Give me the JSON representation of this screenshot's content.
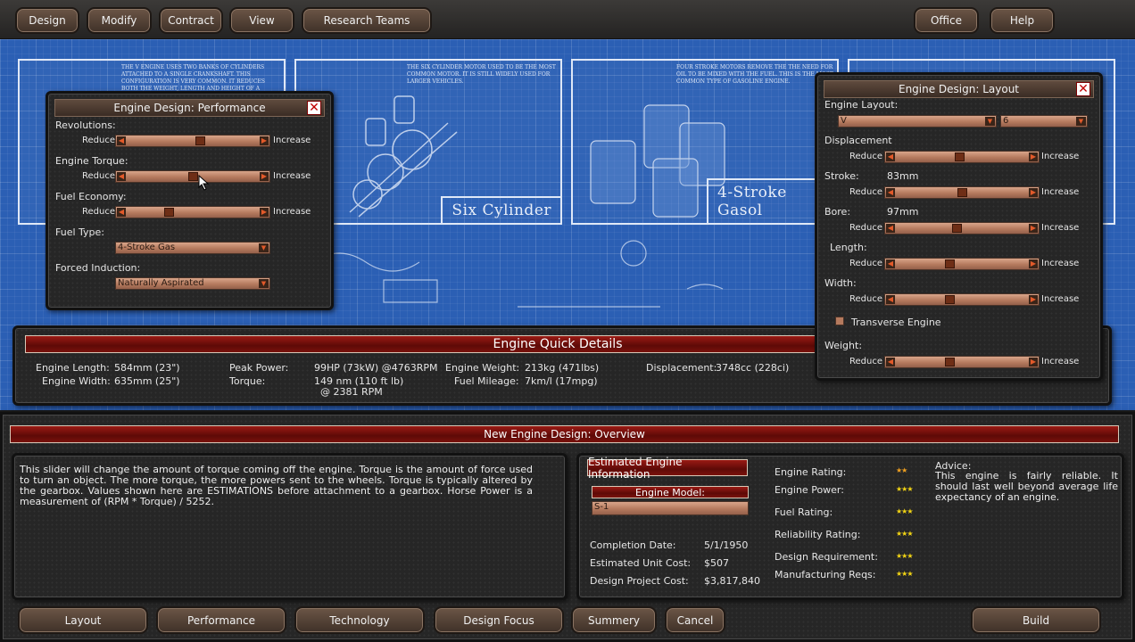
{
  "top_nav": {
    "design": "Design",
    "modify": "Modify",
    "contract": "Contract",
    "view": "View",
    "research_teams": "Research Teams",
    "office": "Office",
    "help": "Help"
  },
  "blueprint": {
    "cards": [
      {
        "caption": "",
        "blurb": "The V engine uses two banks of cylinders attached to a single crankshaft. This configuration is very common. It reduces both the weight, length and height of a straight engine."
      },
      {
        "caption": "Six Cylinder",
        "blurb": "The six cylinder motor used to be the most common motor. It is still widely used for larger vehicles."
      },
      {
        "caption": "4-Stroke Gasol",
        "blurb": "Four stroke motors remove the the need for oil to be mixed with the fuel. This is the most common type of gasoline engine."
      }
    ]
  },
  "performance_panel": {
    "title": "Engine Design: Performance",
    "reduce": "Reduce",
    "increase": "Increase",
    "revolutions_label": "Revolutions:",
    "revolutions_value": 0.56,
    "torque_label": "Engine Torque:",
    "torque_value": 0.5,
    "fuel_economy_label": "Fuel Economy:",
    "fuel_economy_value": 0.31,
    "fuel_type_label": "Fuel Type:",
    "fuel_type_value": "4-Stroke Gas",
    "forced_induction_label": "Forced Induction:",
    "forced_induction_value": "Naturally Aspirated"
  },
  "layout_panel": {
    "title": "Engine Design: Layout",
    "engine_layout_label": "Engine Layout:",
    "layout_value": "V",
    "cylinders_value": "6",
    "reduce": "Reduce",
    "increase": "Increase",
    "displacement_label": "Displacement",
    "displacement_slider": 0.48,
    "stroke_label": "Stroke:",
    "stroke_value": "83mm",
    "stroke_slider": 0.5,
    "bore_label": "Bore:",
    "bore_value": "97mm",
    "bore_slider": 0.46,
    "length_label": "Length:",
    "length_slider": 0.4,
    "width_label": "Width:",
    "width_slider": 0.4,
    "transverse_label": "Transverse Engine",
    "transverse_checked": false,
    "weight_label": "Weight:",
    "weight_slider": 0.4
  },
  "quick_details": {
    "title": "Engine Quick Details",
    "engine_length_label": "Engine Length:",
    "engine_length_value": "584mm (23\")",
    "engine_width_label": "Engine Width:",
    "engine_width_value": "635mm (25\")",
    "peak_power_label": "Peak Power:",
    "peak_power_value": "99HP (73kW) @4763RPM",
    "torque_label": "Torque:",
    "torque_value": "149 nm (110 ft lb)",
    "torque_rpm": "@ 2381 RPM",
    "engine_weight_label": "Engine Weight:",
    "engine_weight_value": "213kg (471lbs)",
    "fuel_mileage_label": "Fuel Mileage:",
    "fuel_mileage_value": "7km/l (17mpg)",
    "displacement_label": "Displacement:",
    "displacement_value": "3748cc (228ci)"
  },
  "overview": {
    "title": "New Engine Design: Overview",
    "description": "This slider will change the amount of torque coming off the engine. Torque is the amount of force used to turn an object. The more torque, the more powers sent to the wheels. Torque is typically altered by the gearbox. Values shown here are ESTIMATIONS before attachment to a gearbox. Horse Power is a measurement of (RPM * Torque) / 5252.",
    "est_info_title": "Estimated Engine Information",
    "engine_model_label": "Engine Model:",
    "engine_model_value": "S-1",
    "completion_date_label": "Completion Date:",
    "completion_date_value": "5/1/1950",
    "unit_cost_label": "Estimated Unit Cost:",
    "unit_cost_value": "$507",
    "project_cost_label": "Design Project Cost:",
    "project_cost_value": "$3,817,840",
    "ratings": [
      {
        "label": "Engine Rating:",
        "stars": 2
      },
      {
        "label": "Engine Power:",
        "stars": 3
      },
      {
        "label": "Fuel Rating:",
        "stars": 3
      },
      {
        "label": "Reliability Rating:",
        "stars": 3
      },
      {
        "label": "Design Requirement:",
        "stars": 3
      },
      {
        "label": "Manufacturing Reqs:",
        "stars": 3
      }
    ],
    "advice_label": "Advice:",
    "advice_text": "This engine is fairly reliable. It should last well beyond average life expectancy of an engine."
  },
  "bottom_nav": {
    "layout": "Layout",
    "performance": "Performance",
    "technology": "Technology",
    "design_focus": "Design Focus",
    "summery": "Summery",
    "cancel": "Cancel",
    "build": "Build"
  }
}
